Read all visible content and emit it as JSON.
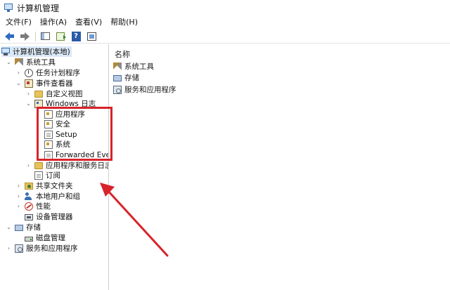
{
  "window": {
    "title": "计算机管理"
  },
  "menu": [
    {
      "label": "文件(F)"
    },
    {
      "label": "操作(A)"
    },
    {
      "label": "查看(V)"
    },
    {
      "label": "帮助(H)"
    }
  ],
  "toolbar": {
    "icons": [
      "back-arrow-icon",
      "forward-arrow-icon",
      "show-hide-console-tree-icon",
      "export-list-icon",
      "help-icon",
      "properties-view-icon"
    ],
    "help_glyph": "?"
  },
  "tree": {
    "root": "计算机管理(本地)",
    "system_tools": "系统工具",
    "task_scheduler": "任务计划程序",
    "event_viewer": "事件查看器",
    "custom_views": "自定义视图",
    "windows_logs": "Windows 日志",
    "application": "应用程序",
    "security": "安全",
    "setup": "Setup",
    "system": "系统",
    "forwarded": "Forwarded Even",
    "app_service_logs": "应用程序和服务日志",
    "subscriptions": "订阅",
    "shared_folders": "共享文件夹",
    "local_users": "本地用户和组",
    "performance": "性能",
    "device_manager": "设备管理器",
    "storage": "存储",
    "disk_management": "磁盘管理",
    "services_apps": "服务和应用程序"
  },
  "content": {
    "column_name": "名称",
    "items": [
      {
        "label": "系统工具",
        "icon": "tools-icon"
      },
      {
        "label": "存储",
        "icon": "storage-icon"
      },
      {
        "label": "服务和应用程序",
        "icon": "services-icon"
      }
    ]
  },
  "annotation": {
    "highlight_color": "#d8232a"
  }
}
